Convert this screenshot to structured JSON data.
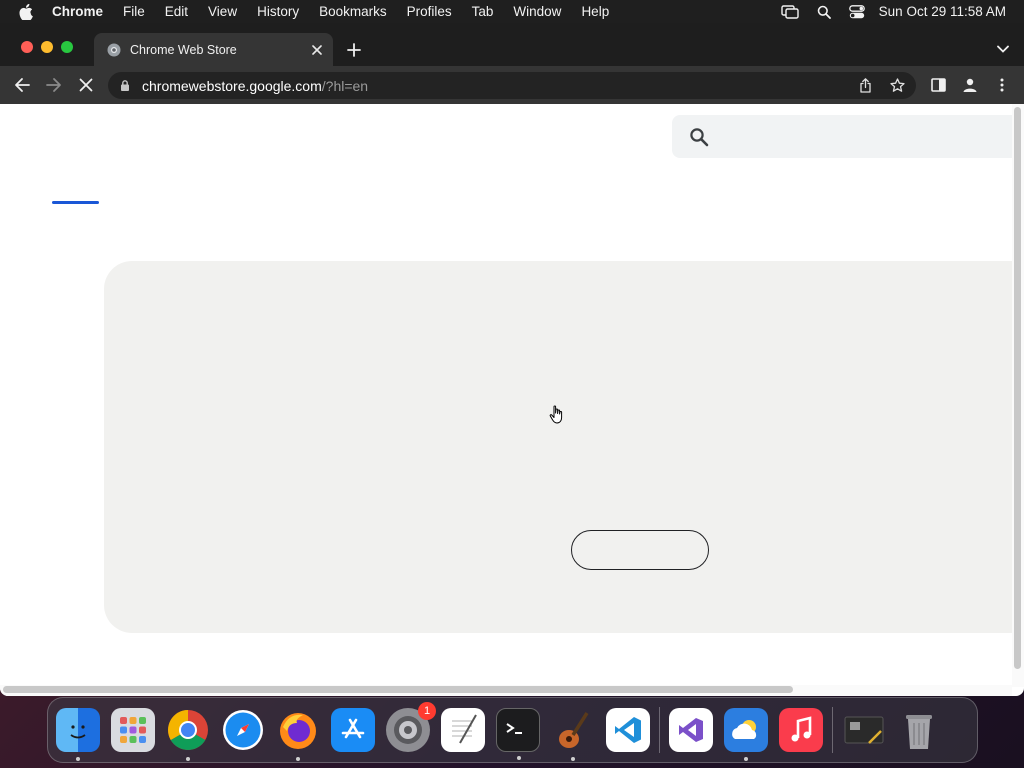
{
  "menubar": {
    "app_name": "Chrome",
    "items": [
      "File",
      "Edit",
      "View",
      "History",
      "Bookmarks",
      "Profiles",
      "Tab",
      "Window",
      "Help"
    ],
    "clock": "Sun Oct 29  11:58 AM",
    "status_icons": [
      "screen-mirroring-icon",
      "spotlight-search-icon",
      "control-center-icon"
    ]
  },
  "browser": {
    "tab": {
      "title": "Chrome Web Store",
      "favicon": "chrome-web-store-icon"
    },
    "address": {
      "host": "chromewebstore.google.com",
      "path": "/?hl=en"
    },
    "toolbar_icons": [
      "back-icon",
      "forward-icon",
      "stop-loading-icon",
      "share-icon",
      "bookmark-star-icon",
      "side-panel-icon",
      "profile-icon",
      "menu-icon"
    ]
  },
  "page": {
    "search": {
      "value": "",
      "placeholder": ""
    },
    "hero_button_label": ""
  },
  "dock": {
    "apps": [
      "Finder",
      "Launchpad",
      "Google Chrome",
      "Safari",
      "Firefox",
      "App Store",
      "System Settings",
      "TextEdit",
      "Terminal",
      "GarageBand",
      "Visual Studio Code",
      "Visual Studio",
      "Weather",
      "Music",
      "Preview",
      "Trash"
    ],
    "system_settings_badge": "1"
  },
  "colors": {
    "accent_blue": "#1a57d6",
    "hero_background": "#f1f1ef",
    "chrome_dark": "#353535"
  }
}
